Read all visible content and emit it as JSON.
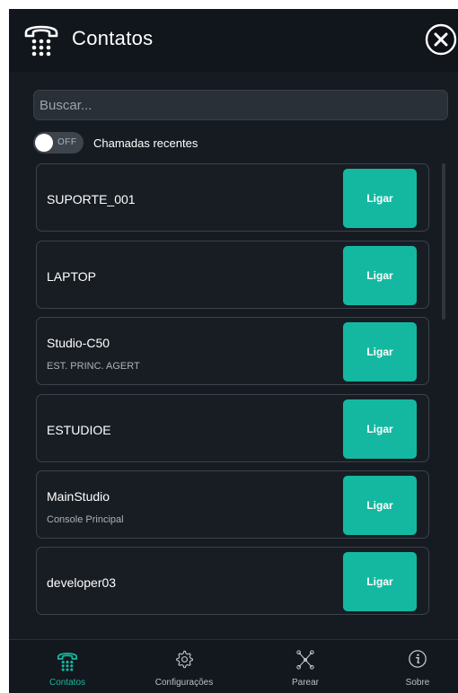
{
  "header": {
    "title": "Contatos",
    "icon": "phone-keypad-icon",
    "close_icon": "close-icon"
  },
  "search": {
    "placeholder": "Buscar...",
    "value": ""
  },
  "recent_calls": {
    "toggle_state": "OFF",
    "label": "Chamadas recentes"
  },
  "contacts": [
    {
      "name": "SUPORTE_001",
      "subtitle": "",
      "action": "Ligar"
    },
    {
      "name": "LAPTOP",
      "subtitle": "",
      "action": "Ligar"
    },
    {
      "name": "Studio-C50",
      "subtitle": "EST. PRINC. AGERT",
      "action": "Ligar"
    },
    {
      "name": "ESTUDIOE",
      "subtitle": "",
      "action": "Ligar"
    },
    {
      "name": "MainStudio",
      "subtitle": "Console Principal",
      "action": "Ligar"
    },
    {
      "name": "developer03",
      "subtitle": "",
      "action": "Ligar"
    }
  ],
  "bottom_nav": {
    "items": [
      {
        "label": "Contatos",
        "icon": "phone-keypad-icon",
        "active": true
      },
      {
        "label": "Configurações",
        "icon": "gear-icon",
        "active": false
      },
      {
        "label": "Parear",
        "icon": "network-nodes-icon",
        "active": false
      },
      {
        "label": "Sobre",
        "icon": "info-icon",
        "active": false
      }
    ]
  },
  "colors": {
    "background": "#161b22",
    "accent": "#14b8a0",
    "card_border": "#3a424c",
    "text": "#ffffff",
    "muted_text": "#aab2ba"
  }
}
